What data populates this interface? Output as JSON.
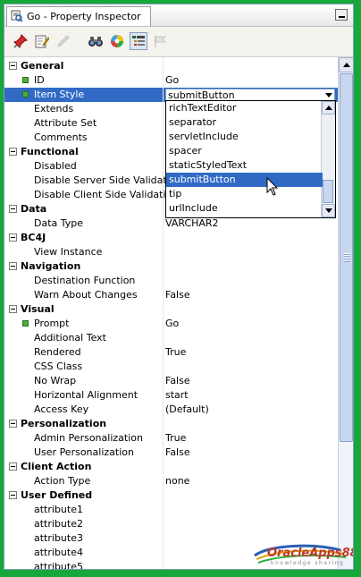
{
  "panel": {
    "tab_title": "Go - Property Inspector",
    "minimize_icon": "minimize-icon"
  },
  "toolbar": {
    "icons": [
      "pin-icon",
      "edit-properties-icon",
      "pencil-icon",
      "binoculars-icon",
      "color-wheel-icon",
      "categorized-view-icon",
      "flag-icon"
    ]
  },
  "rows": [
    {
      "type": "category",
      "label": "General"
    },
    {
      "type": "prop",
      "label": "ID",
      "value": "Go",
      "required": true
    },
    {
      "type": "prop",
      "label": "Item Style",
      "value": "submitButton",
      "required": true,
      "selected": true
    },
    {
      "type": "prop",
      "label": "Extends",
      "value": ""
    },
    {
      "type": "prop",
      "label": "Attribute Set",
      "value": ""
    },
    {
      "type": "prop",
      "label": "Comments",
      "value": ""
    },
    {
      "type": "category",
      "label": "Functional"
    },
    {
      "type": "prop",
      "label": "Disabled",
      "value": ""
    },
    {
      "type": "prop",
      "label": "Disable Server Side Validation",
      "value": ""
    },
    {
      "type": "prop",
      "label": "Disable Client Side Validation",
      "value": ""
    },
    {
      "type": "category",
      "label": "Data"
    },
    {
      "type": "prop",
      "label": "Data Type",
      "value": "VARCHAR2"
    },
    {
      "type": "category",
      "label": "BC4J"
    },
    {
      "type": "prop",
      "label": "View Instance",
      "value": ""
    },
    {
      "type": "category",
      "label": "Navigation"
    },
    {
      "type": "prop",
      "label": "Destination Function",
      "value": ""
    },
    {
      "type": "prop",
      "label": "Warn About Changes",
      "value": "False"
    },
    {
      "type": "category",
      "label": "Visual"
    },
    {
      "type": "prop",
      "label": "Prompt",
      "value": "Go",
      "required": true
    },
    {
      "type": "prop",
      "label": "Additional Text",
      "value": ""
    },
    {
      "type": "prop",
      "label": "Rendered",
      "value": "True"
    },
    {
      "type": "prop",
      "label": "CSS Class",
      "value": ""
    },
    {
      "type": "prop",
      "label": "No Wrap",
      "value": "False"
    },
    {
      "type": "prop",
      "label": "Horizontal Alignment",
      "value": "start"
    },
    {
      "type": "prop",
      "label": "Access Key",
      "value": "(Default)"
    },
    {
      "type": "category",
      "label": "Personalization"
    },
    {
      "type": "prop",
      "label": "Admin Personalization",
      "value": "True"
    },
    {
      "type": "prop",
      "label": "User Personalization",
      "value": "False"
    },
    {
      "type": "category",
      "label": "Client Action"
    },
    {
      "type": "prop",
      "label": "Action Type",
      "value": "none"
    },
    {
      "type": "category",
      "label": "User Defined"
    },
    {
      "type": "prop",
      "label": "attribute1",
      "value": ""
    },
    {
      "type": "prop",
      "label": "attribute2",
      "value": ""
    },
    {
      "type": "prop",
      "label": "attribute3",
      "value": ""
    },
    {
      "type": "prop",
      "label": "attribute4",
      "value": ""
    },
    {
      "type": "prop",
      "label": "attribute5",
      "value": ""
    }
  ],
  "dropdown": {
    "options": [
      "richTextEditor",
      "separator",
      "servletInclude",
      "spacer",
      "staticStyledText",
      "submitButton",
      "tip",
      "urlInclude"
    ],
    "highlighted": "submitButton"
  },
  "watermark": {
    "brand": "OracleApps88",
    "tagline": "knowledge sharing"
  },
  "colors": {
    "frame": "#16a83a",
    "selection": "#316ac5",
    "required_marker": "#4caf3a"
  }
}
